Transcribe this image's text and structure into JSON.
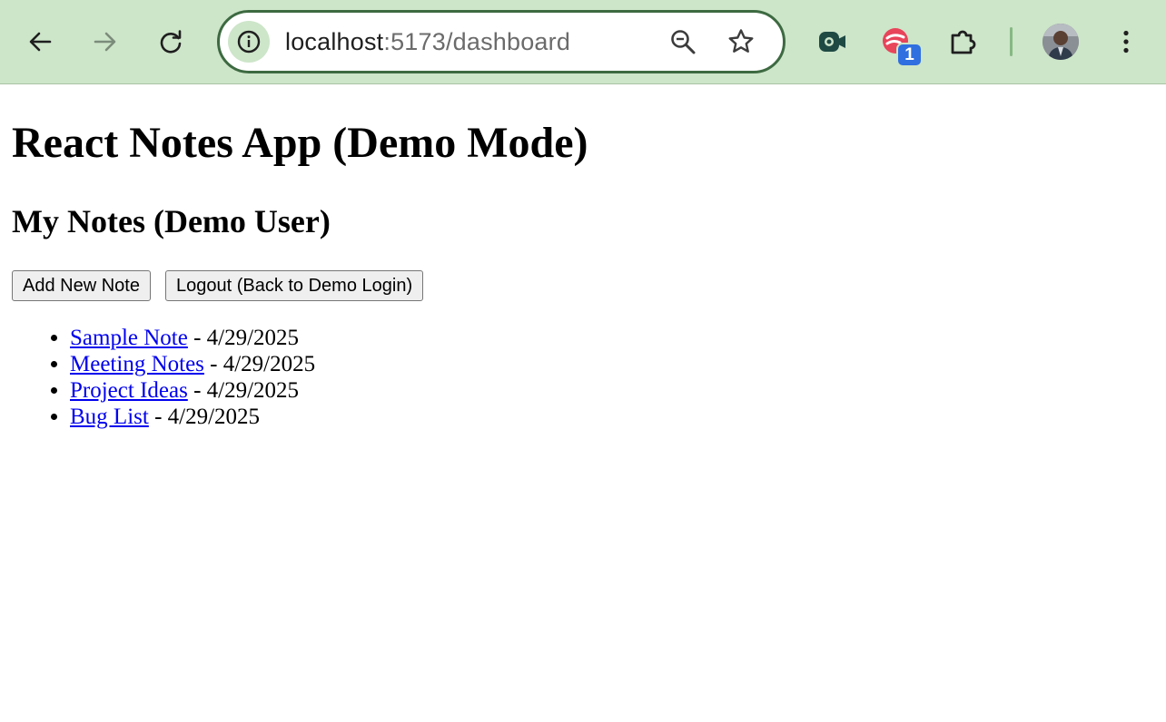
{
  "browser": {
    "url_host": "localhost",
    "url_rest": ":5173/dashboard",
    "extension_badge": "1",
    "icons": [
      "back-arrow-icon",
      "forward-arrow-icon",
      "reload-icon",
      "site-info-icon",
      "zoom-icon",
      "bookmark-star-icon",
      "screen-recorder-extension-icon",
      "extension-icon",
      "puzzle-extensions-icon",
      "profile-avatar",
      "kebab-menu-icon"
    ],
    "colors": {
      "toolbar": "#cde5c9",
      "omnibox_border": "#3d6a41",
      "badge": "#2f6fe0"
    }
  },
  "page": {
    "title": "React Notes App (Demo Mode)",
    "subtitle": "My Notes (Demo User)",
    "add_button": "Add New Note",
    "logout_button": "Logout (Back to Demo Login)",
    "notes": [
      {
        "title": "Sample Note",
        "date": " - 4/29/2025"
      },
      {
        "title": "Meeting Notes",
        "date": " - 4/29/2025"
      },
      {
        "title": "Project Ideas",
        "date": " - 4/29/2025"
      },
      {
        "title": "Bug List",
        "date": " - 4/29/2025"
      }
    ]
  }
}
